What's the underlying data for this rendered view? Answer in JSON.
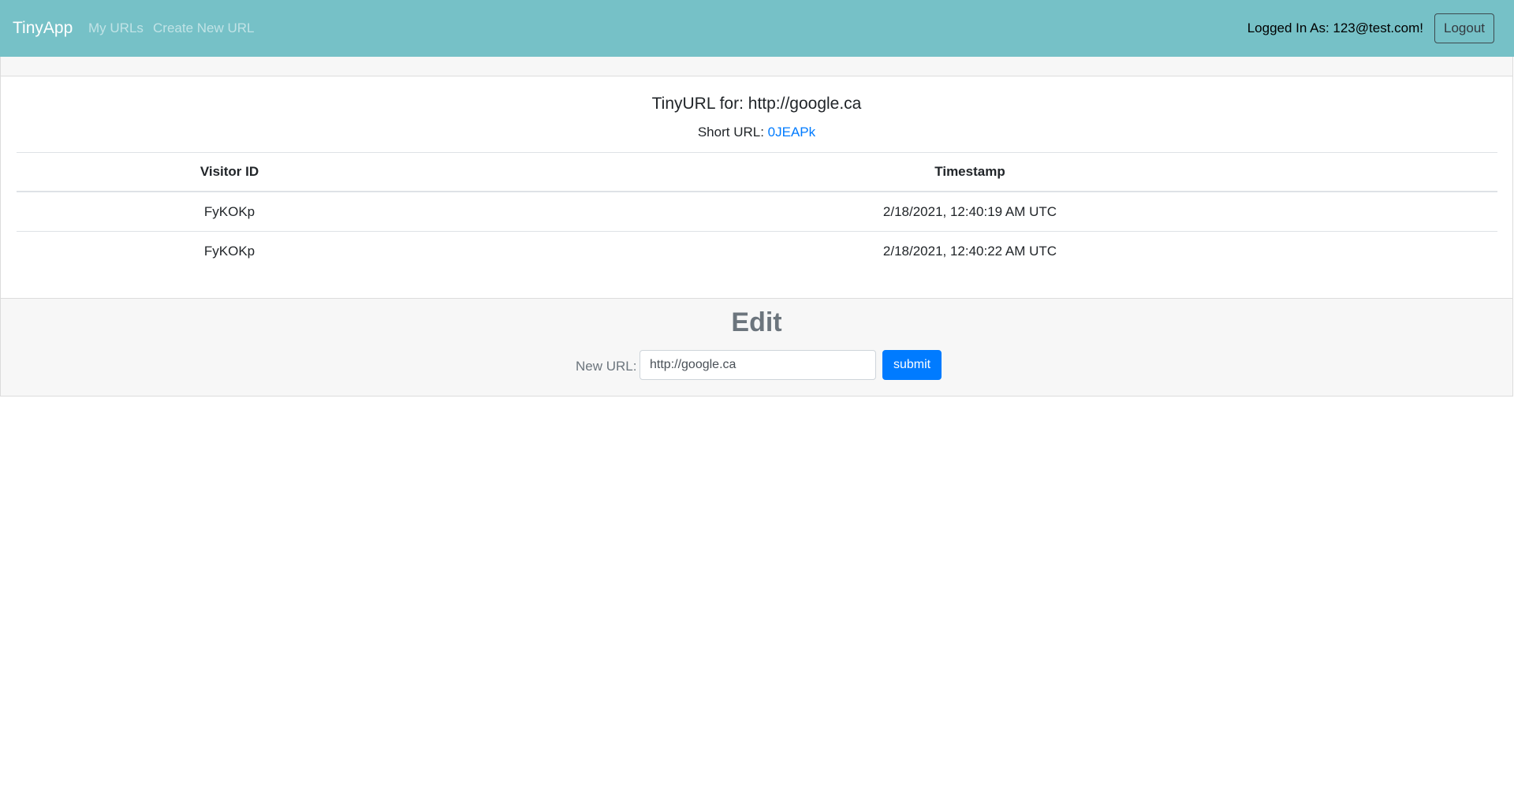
{
  "navbar": {
    "brand": "TinyApp",
    "links": [
      {
        "label": "My URLs"
      },
      {
        "label": "Create New URL"
      }
    ],
    "logged_in_text": "Logged In As: 123@test.com!",
    "logout_label": "Logout"
  },
  "card": {
    "title": "TinyURL for: http://google.ca",
    "short_url_label": "Short URL:",
    "short_url_value": "0JEAPk",
    "table": {
      "headers": [
        "Visitor ID",
        "Timestamp"
      ],
      "rows": [
        {
          "visitor_id": "FyKOKp",
          "timestamp": "2/18/2021, 12:40:19 AM UTC"
        },
        {
          "visitor_id": "FyKOKp",
          "timestamp": "2/18/2021, 12:40:22 AM UTC"
        }
      ]
    }
  },
  "edit": {
    "title": "Edit",
    "new_url_label": "New URL:",
    "new_url_value": "http://google.ca",
    "submit_label": "submit"
  },
  "colors": {
    "navbar_bg": "#76c1c7",
    "link_blue": "#007bff",
    "submit_bg": "#007bff",
    "muted_text": "#6c757d"
  }
}
